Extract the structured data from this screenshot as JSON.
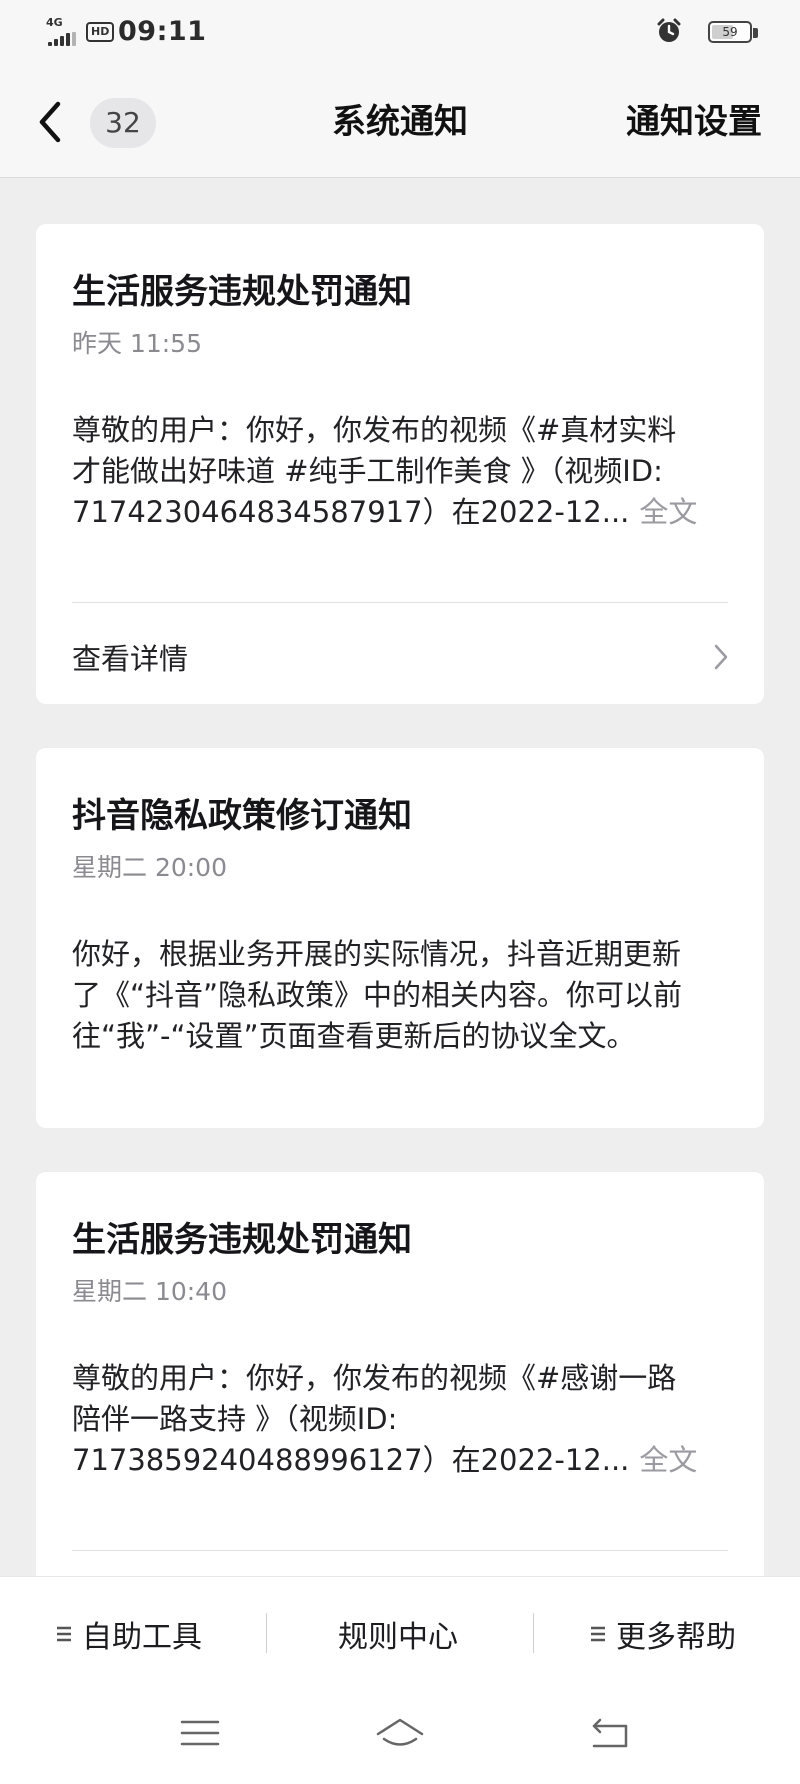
{
  "status_bar": {
    "network": "4G",
    "hd_label": "HD",
    "time": "09:11",
    "battery_level": "59",
    "battery_fraction": 0.59
  },
  "nav": {
    "back_icon": "chevron-left-icon",
    "unread_count": "32",
    "title": "系统通知",
    "settings_label": "通知设置"
  },
  "notifications": [
    {
      "title": "生活服务违规处罚通知",
      "time": "昨天 11:55",
      "body_lines": [
        "尊敬的用户：你好，你发布的视频《#真材实料",
        "才能做出好味道 #纯手工制作美食 》（视频ID:",
        "7174230464834587917）在2022-12..."
      ],
      "full_text_label": "全文",
      "details_label": "查看详情"
    },
    {
      "title": "抖音隐私政策修订通知",
      "time": "星期二 20:00",
      "body_lines": [
        "你好，根据业务开展的实际情况，抖音近期更新",
        "了《“抖音”隐私政策》中的相关内容。你可以前",
        "往“我”-“设置”页面查看更新后的协议全文。"
      ]
    },
    {
      "title": "生活服务违规处罚通知",
      "time": "星期二 10:40",
      "body_lines": [
        "尊敬的用户：你好，你发布的视频《#感谢一路",
        "陪伴一路支持 》（视频ID:",
        "7173859240488996127）在2022-12..."
      ],
      "full_text_label": "全文"
    }
  ],
  "bottom_toolbar": {
    "items": [
      {
        "label": "自助工具",
        "icon": "menu-icon"
      },
      {
        "label": "规则中心",
        "icon": ""
      },
      {
        "label": "更多帮助",
        "icon": "menu-icon"
      }
    ]
  },
  "system_nav": {
    "icons": [
      "menu-icon",
      "home-icon",
      "back-icon"
    ]
  },
  "colors": {
    "background": "#eeeeef",
    "card": "#ffffff",
    "secondary_text": "#8a8a90",
    "link_gray": "#9a9aa0"
  }
}
